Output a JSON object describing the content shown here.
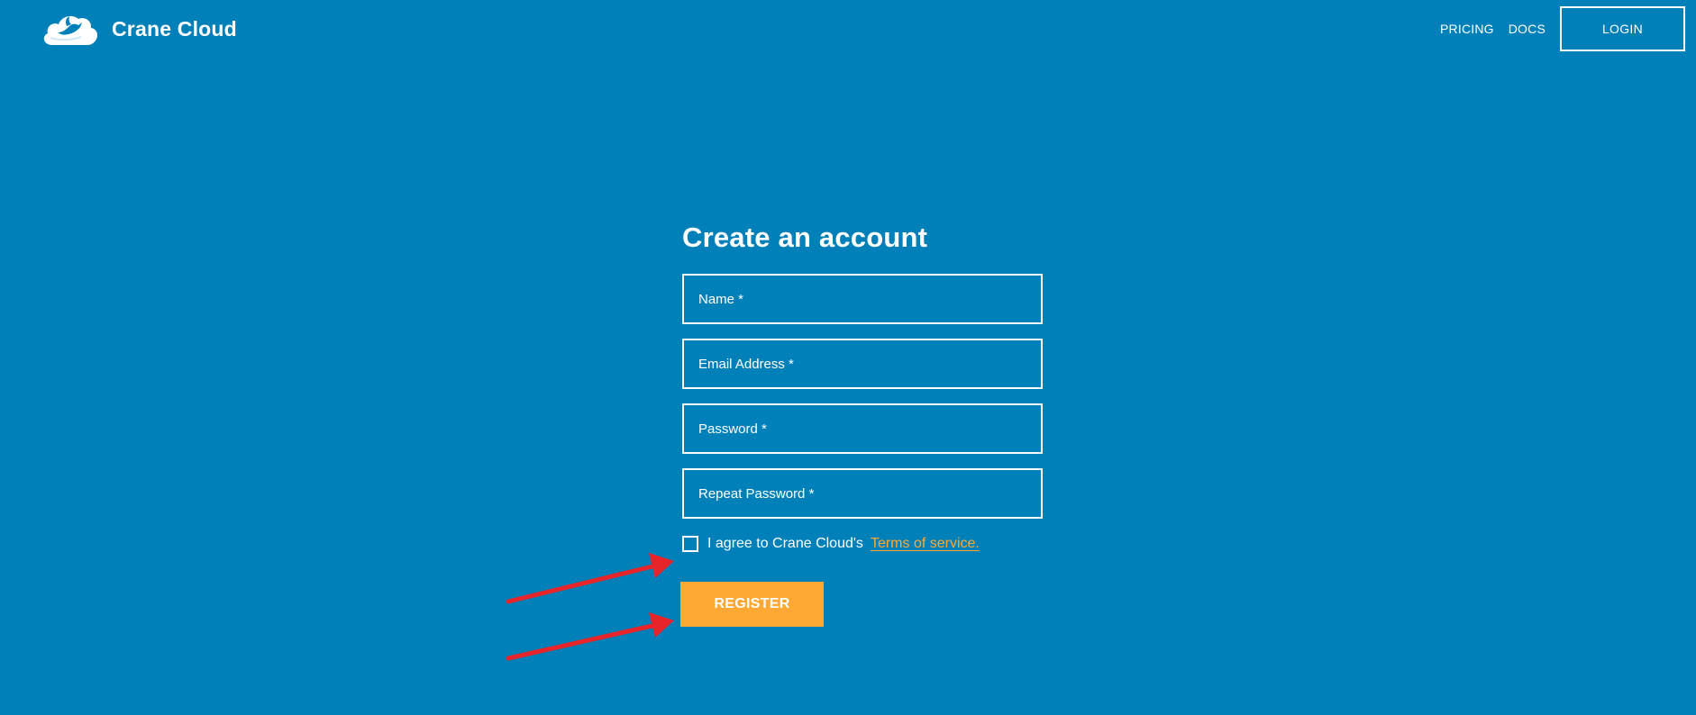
{
  "header": {
    "brand": "Crane Cloud",
    "nav": {
      "pricing": "PRICING",
      "docs": "DOCS",
      "login": "LOGIN"
    }
  },
  "form": {
    "title": "Create an account",
    "fields": {
      "name_placeholder": "Name *",
      "email_placeholder": "Email Address *",
      "password_placeholder": "Password *",
      "repeat_password_placeholder": "Repeat Password *"
    },
    "terms": {
      "text": "I agree to Crane Cloud's",
      "link": "Terms of service.",
      "checked": false
    },
    "register_label": "REGISTER"
  },
  "colors": {
    "background": "#0080b9",
    "accent": "#ffa934",
    "annotation_arrow": "#e8242b"
  },
  "icons": {
    "logo": "crane-cloud-logo",
    "annotation": "red-arrow"
  }
}
